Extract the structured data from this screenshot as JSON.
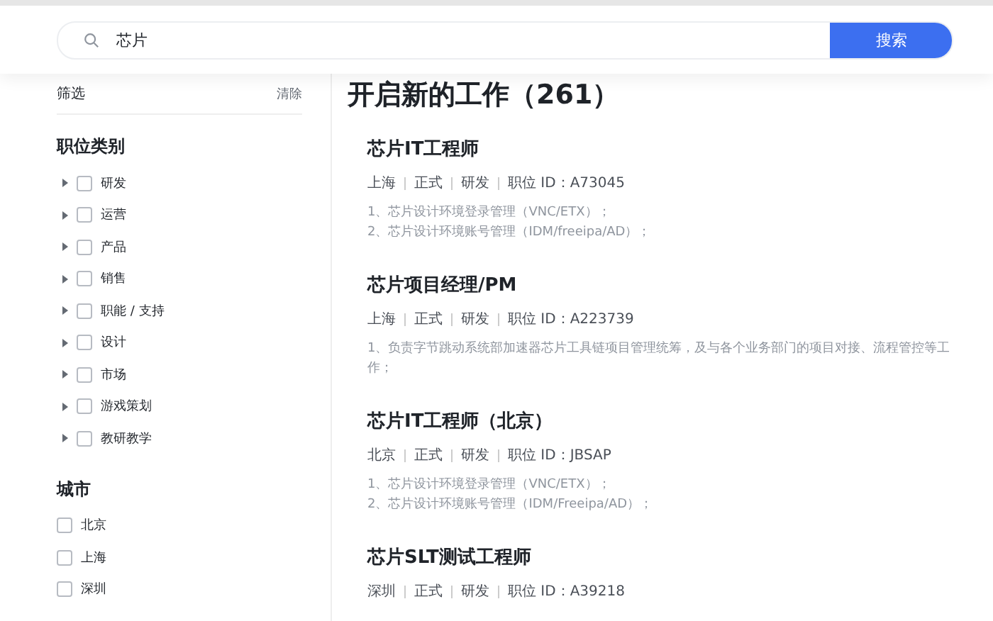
{
  "search": {
    "value": "芯片",
    "button": "搜索"
  },
  "filter": {
    "title": "筛选",
    "clear": "清除",
    "groups": [
      {
        "title": "职位类别",
        "items": [
          {
            "label": "研发",
            "checked": false,
            "expanded": false
          },
          {
            "label": "运营",
            "checked": false,
            "expanded": false
          },
          {
            "label": "产品",
            "checked": false,
            "expanded": false
          },
          {
            "label": "销售",
            "checked": false,
            "expanded": false
          },
          {
            "label": "职能 / 支持",
            "checked": false,
            "expanded": false
          },
          {
            "label": "设计",
            "checked": false,
            "expanded": false
          },
          {
            "label": "市场",
            "checked": false,
            "expanded": false
          },
          {
            "label": "游戏策划",
            "checked": false,
            "expanded": false
          },
          {
            "label": "教研教学",
            "checked": false,
            "expanded": false
          }
        ]
      },
      {
        "title": "城市",
        "items": [
          {
            "label": "北京",
            "checked": false
          },
          {
            "label": "上海",
            "checked": false
          },
          {
            "label": "深圳",
            "checked": false
          }
        ]
      }
    ]
  },
  "results": {
    "title": "开启新的工作（261）",
    "jobs": [
      {
        "title": "芯片IT工程师",
        "meta": [
          "上海",
          "正式",
          "研发",
          "职位 ID：A73045"
        ],
        "description": [
          "1、芯片设计环境登录管理（VNC/ETX）；",
          "2、芯片设计环境账号管理（IDM/freeipa/AD）；"
        ]
      },
      {
        "title": "芯片项目经理/PM",
        "meta": [
          "上海",
          "正式",
          "研发",
          "职位 ID：A223739"
        ],
        "description": [
          "1、负责字节跳动系统部加速器芯片工具链项目管理统筹，及与各个业务部门的项目对接、流程管控等工作；"
        ]
      },
      {
        "title": "芯片IT工程师（北京）",
        "meta": [
          "北京",
          "正式",
          "研发",
          "职位 ID：JBSAP"
        ],
        "description": [
          "1、芯片设计环境登录管理（VNC/ETX）；",
          "2、芯片设计环境账号管理（IDM/Freeipa/AD）；"
        ]
      },
      {
        "title": "芯片SLT测试工程师",
        "meta": [
          "深圳",
          "正式",
          "研发",
          "职位 ID：A39218"
        ]
      }
    ]
  }
}
